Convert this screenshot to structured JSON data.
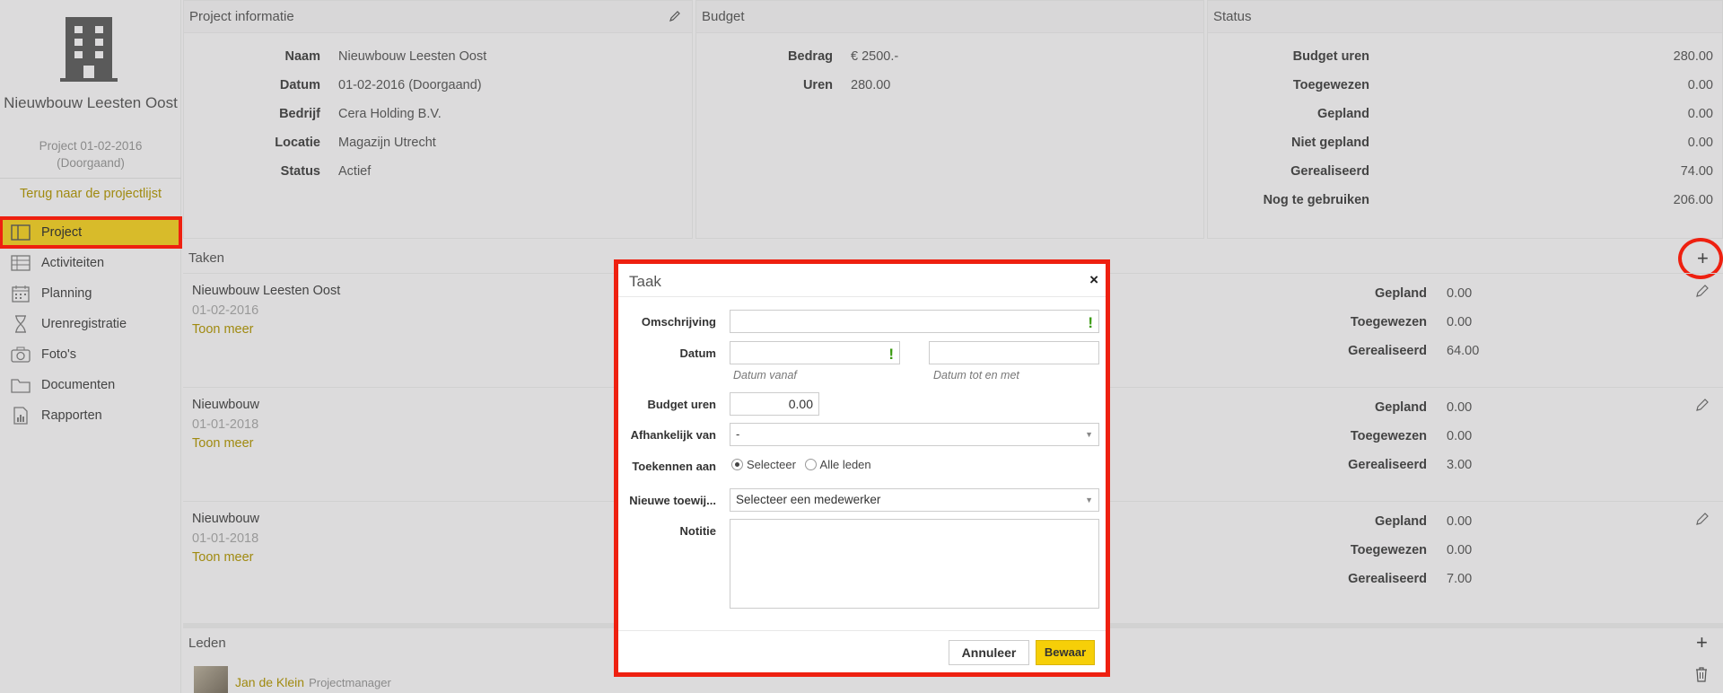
{
  "sidebar": {
    "project_name": "Nieuwbouw Leesten Oost",
    "project_sub_1": "Project 01-02-2016",
    "project_sub_2": "(Doorgaand)",
    "back_link": "Terug naar de projectlijst",
    "items": [
      {
        "label": "Project",
        "icon": "project-icon"
      },
      {
        "label": "Activiteiten",
        "icon": "table-icon"
      },
      {
        "label": "Planning",
        "icon": "calendar-icon"
      },
      {
        "label": "Urenregistratie",
        "icon": "hourglass-icon"
      },
      {
        "label": "Foto's",
        "icon": "camera-icon"
      },
      {
        "label": "Documenten",
        "icon": "folder-icon"
      },
      {
        "label": "Rapporten",
        "icon": "report-icon"
      }
    ]
  },
  "info": {
    "title": "Project informatie",
    "rows": [
      {
        "k": "Naam",
        "v": "Nieuwbouw Leesten Oost"
      },
      {
        "k": "Datum",
        "v": "01-02-2016 (Doorgaand)"
      },
      {
        "k": "Bedrijf",
        "v": "Cera Holding B.V."
      },
      {
        "k": "Locatie",
        "v": "Magazijn Utrecht"
      },
      {
        "k": "Status",
        "v": "Actief"
      }
    ]
  },
  "budget": {
    "title": "Budget",
    "rows": [
      {
        "k": "Bedrag",
        "v": "€ 2500.-"
      },
      {
        "k": "Uren",
        "v": "280.00"
      }
    ]
  },
  "status": {
    "title": "Status",
    "rows": [
      {
        "k": "Budget uren",
        "v": "280.00"
      },
      {
        "k": "Toegewezen",
        "v": "0.00"
      },
      {
        "k": "Gepland",
        "v": "0.00"
      },
      {
        "k": "Niet gepland",
        "v": "0.00"
      },
      {
        "k": "Gerealiseerd",
        "v": "74.00"
      },
      {
        "k": "Nog te gebruiken",
        "v": "206.00"
      }
    ]
  },
  "taken": {
    "title": "Taken",
    "plus": "+",
    "more_label": "Toon meer",
    "labels": {
      "gepland": "Gepland",
      "toegewezen": "Toegewezen",
      "gerealiseerd": "Gerealiseerd"
    },
    "items": [
      {
        "name": "Nieuwbouw Leesten Oost",
        "date": "01-02-2016",
        "gepland": "0.00",
        "toegewezen": "0.00",
        "gerealiseerd": "64.00"
      },
      {
        "name": "Nieuwbouw",
        "date": "01-01-2018",
        "gepland": "0.00",
        "toegewezen": "0.00",
        "gerealiseerd": "3.00"
      },
      {
        "name": "Nieuwbouw",
        "date": "01-01-2018",
        "gepland": "0.00",
        "toegewezen": "0.00",
        "gerealiseerd": "7.00"
      }
    ]
  },
  "leden": {
    "title": "Leden",
    "plus": "+",
    "member": {
      "name": "Jan de Klein",
      "role": "Projectmanager"
    }
  },
  "modal": {
    "title": "Taak",
    "close": "×",
    "labels": {
      "omschrijving": "Omschrijving",
      "datum": "Datum",
      "budget_uren": "Budget uren",
      "afhankelijk": "Afhankelijk van",
      "toekennen": "Toekennen aan",
      "nieuwe": "Nieuwe toewij...",
      "notitie": "Notitie"
    },
    "omschrijving_value": "",
    "datum_vanaf_value": "",
    "datum_tot_value": "",
    "hint_vanaf": "Datum vanaf",
    "hint_tot": "Datum tot en met",
    "budget_uren_value": "0.00",
    "afhankelijk_value": "-",
    "radio_selecteer": "Selecteer",
    "radio_alle": "Alle leden",
    "radio_selected": "Selecteer",
    "nieuwe_value": "Selecteer een medewerker",
    "notitie_value": "",
    "required_mark": "!",
    "cancel_label": "Annuleer",
    "save_label": "Bewaar"
  },
  "colors": {
    "accent": "#d8bb2a",
    "highlight": "#ee2010",
    "link": "#a08a10",
    "save": "#f6cf08"
  }
}
